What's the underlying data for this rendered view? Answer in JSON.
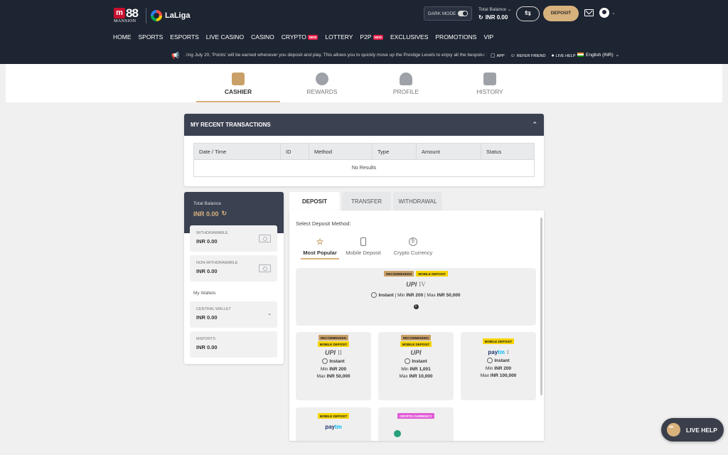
{
  "header": {
    "logo_text": "88",
    "logo_sub": "MANSION",
    "laliga_text": "LaLiga",
    "dark_mode_label": "DARK MODE",
    "total_balance_label": "Total Balance",
    "total_balance_value": "INR 0.00",
    "deposit_label": "DEPOSIT"
  },
  "nav": {
    "items": [
      {
        "label": "HOME"
      },
      {
        "label": "SPORTS"
      },
      {
        "label": "ESPORTS"
      },
      {
        "label": "LIVE CASINO"
      },
      {
        "label": "CASINO"
      },
      {
        "label": "CRYPTO",
        "badge": "NEW"
      },
      {
        "label": "LOTTERY"
      },
      {
        "label": "P2P",
        "badge": "NEW"
      },
      {
        "label": "EXCLUSIVES"
      },
      {
        "label": "PROMOTIONS"
      },
      {
        "label": "VIP"
      }
    ]
  },
  "ticker": {
    "text": "...ting July 20, 'Points' will be earned whenever you deposit and play. This allows you to quickly move up the Prestige Levels to enjoy all the bespoke bene...",
    "links": {
      "app": "APP",
      "refer": "REFER FRIEND",
      "live_help": "LIVE HELP"
    },
    "language": "English (INR)"
  },
  "subnav": {
    "cashier": "CASHIER",
    "rewards": "REWARDS",
    "profile": "PROFILE",
    "history": "HISTORY"
  },
  "transactions": {
    "title": "MY RECENT TRANSACTIONS",
    "columns": [
      "Date / Time",
      "ID",
      "Method",
      "Type",
      "Amount",
      "Status"
    ],
    "empty_text": "No Results"
  },
  "balance_card": {
    "total_label": "Total Balance",
    "total_value": "INR 0.00",
    "withdrawable_label": "WITHDRAWABLE",
    "withdrawable_value": "INR 0.00",
    "non_withdrawable_label": "NON-WITHDRAWABLE",
    "non_withdrawable_value": "INR 0.00",
    "wallets_label": "My Wallets",
    "central_label": "CENTRAL WALLET",
    "central_value": "INR 0.00",
    "msports_label": "MSPORTS",
    "msports_value": "INR 0.00"
  },
  "tabs": {
    "deposit": "DEPOSIT",
    "transfer": "TRANSFER",
    "withdrawal": "WITHDRAWAL"
  },
  "deposit": {
    "select_label": "Select Deposit Method:",
    "categories": {
      "popular": "Most Popular",
      "mobile": "Mobile Deposit",
      "crypto": "Crypto Currency"
    },
    "badges": {
      "recommended": "RECOMMENDED",
      "mobile": "MOBILE DEPOSIT",
      "crypto": "CRYPTO CURRENCY"
    },
    "methods": [
      {
        "logo": "UPI",
        "tier": "IV",
        "speed": "Instant",
        "min_label": "Min",
        "min": "INR 200",
        "max_label": "Max",
        "max": "INR 50,000"
      },
      {
        "logo": "UPI",
        "tier": "II",
        "speed": "Instant",
        "min_label": "Min",
        "min": "INR 200",
        "max_label": "Max",
        "max": "INR 50,000"
      },
      {
        "logo": "UPI",
        "tier": "",
        "speed": "Instant",
        "min_label": "Min",
        "min": "INR 1,001",
        "max_label": "Max",
        "max": "INR 10,000"
      },
      {
        "logo_a": "pay",
        "logo_b": "tm",
        "tier": "I",
        "speed": "Instant",
        "min_label": "Min",
        "min": "INR 200",
        "max_label": "Max",
        "max": "INR 100,000"
      },
      {
        "logo_a": "pay",
        "logo_b": "tm"
      }
    ]
  },
  "live_help": {
    "label": "LIVE HELP"
  },
  "colors": {
    "header_bg": "#1e2532",
    "gold": "#d8b27c",
    "panel_head": "#3a4151",
    "new_badge": "#e8214a"
  }
}
